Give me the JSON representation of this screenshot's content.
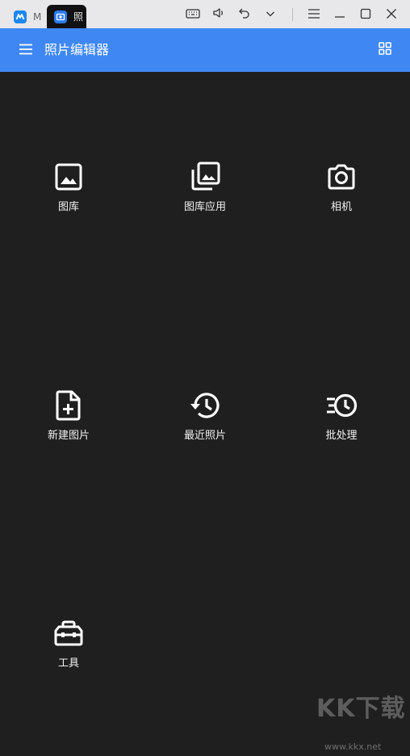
{
  "titlebar": {
    "tabs": [
      {
        "label": "M",
        "icon": "app-logo-icon",
        "active": false
      },
      {
        "label": "照",
        "icon": "photo-editor-app-icon",
        "active": true
      }
    ],
    "controls": [
      "keyboard-icon",
      "volume-icon",
      "undo-icon",
      "chevron-down-icon",
      "menu-lines-icon",
      "minimize-icon",
      "maximize-icon",
      "close-icon"
    ]
  },
  "appbar": {
    "title": "照片编辑器",
    "background": "#3f88f3",
    "menu_icon": "hamburger-menu-icon",
    "view_icon": "grid-view-icon"
  },
  "items": [
    {
      "label": "图库",
      "icon": "image-icon"
    },
    {
      "label": "图库应用",
      "icon": "image-stack-icon"
    },
    {
      "label": "相机",
      "icon": "camera-icon"
    },
    {
      "label": "新建图片",
      "icon": "file-plus-icon"
    },
    {
      "label": "最近照片",
      "icon": "history-icon"
    },
    {
      "label": "批处理",
      "icon": "batch-clock-icon"
    },
    {
      "label": "工具",
      "icon": "toolbox-icon"
    }
  ],
  "watermark": {
    "text": "KK下载",
    "url": "www.kkx.net"
  },
  "colors": {
    "background": "#1f1f1f",
    "titlebar": "#e8e8ea",
    "accent": "#3f88f3",
    "text": "#f2f2f2"
  }
}
